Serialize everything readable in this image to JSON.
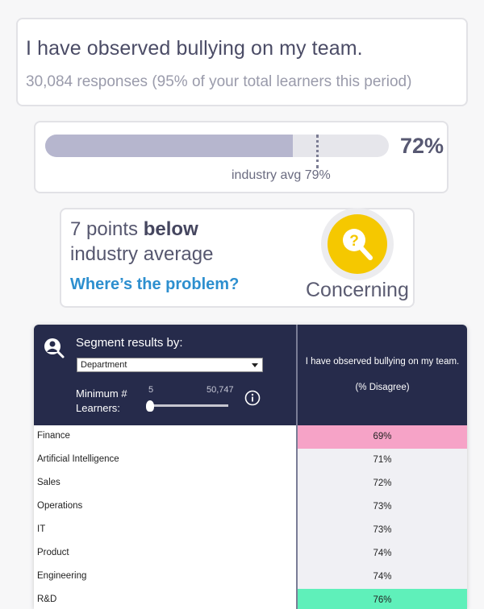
{
  "question": {
    "title": "I have observed bullying on my team.",
    "responses": "30,084 responses (95% of your total learners this period)"
  },
  "score": {
    "value_label": "72%",
    "value": 0.72,
    "industry_avg": 0.79,
    "industry_label": "industry avg 79%",
    "colors": {
      "fill": "#b6b6ce",
      "track": "#e6e6eb"
    }
  },
  "insight": {
    "line1_prefix": "7 points ",
    "line1_bold": "below",
    "line2": "industry average",
    "link": "Where’s the problem?",
    "badge_icon": "magnifier-question-icon",
    "badge_label": "Concerning",
    "badge_color": "#f5c800"
  },
  "segment": {
    "title": "Segment results by:",
    "user_icon": "user-search-icon",
    "selected": "Department",
    "min_label_1": "Minimum #",
    "min_label_2": "Learners:",
    "slider_min": "5",
    "slider_max": "50,747",
    "slider_value": 5,
    "info_icon": "info-icon",
    "column_header_1": "I have observed bullying on my team.",
    "column_header_2": "(% Disagree)",
    "header_color": "#262b4b",
    "rows": [
      {
        "name": "Finance",
        "value": "69%",
        "flag": "low"
      },
      {
        "name": "Artificial Intelligence",
        "value": "71%",
        "flag": ""
      },
      {
        "name": "Sales",
        "value": "72%",
        "flag": ""
      },
      {
        "name": "Operations",
        "value": "73%",
        "flag": ""
      },
      {
        "name": "IT",
        "value": "73%",
        "flag": ""
      },
      {
        "name": "Product",
        "value": "74%",
        "flag": ""
      },
      {
        "name": "Engineering",
        "value": "74%",
        "flag": ""
      },
      {
        "name": "R&D",
        "value": "76%",
        "flag": "high"
      }
    ]
  }
}
